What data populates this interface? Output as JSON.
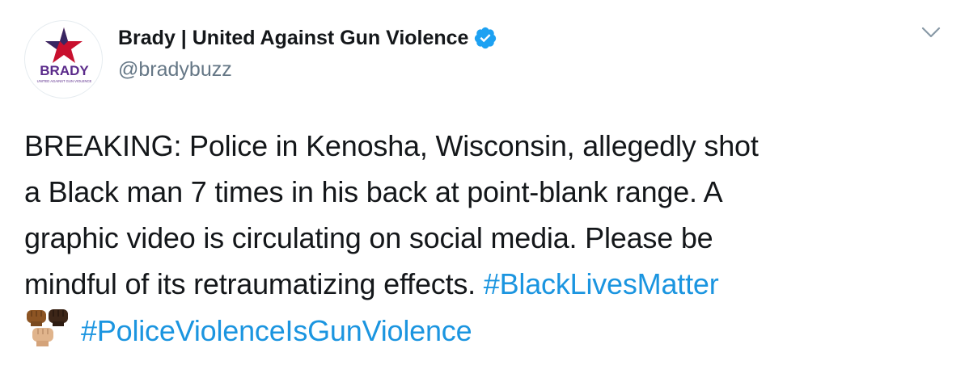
{
  "tweet": {
    "display_name": "Brady | United Against Gun Violence",
    "handle": "@bradybuzz",
    "verified": true,
    "avatar": {
      "logo_text": "BRADY",
      "logo_subtext": "UNITED AGAINST GUN VIOLENCE",
      "star_color": "#c8102e",
      "text_color": "#5a2a8a"
    },
    "menu_icon": "chevron-down-icon",
    "body": {
      "line1": "BREAKING: Police in Kenosha, Wisconsin, allegedly shot",
      "line2": "a Black man 7 times in his back at point-blank range. A",
      "line3": "graphic video is circulating on social media. Please be",
      "line4_text": "mindful of its retraumatizing effects. ",
      "hashtag1": "#BlackLivesMatter",
      "emoji": "raised-fists-emoji",
      "hashtag2": "#PoliceViolenceIsGunViolence"
    },
    "colors": {
      "text": "#14171a",
      "secondary": "#657786",
      "link": "#1b95e0",
      "verified": "#1da1f2"
    }
  }
}
